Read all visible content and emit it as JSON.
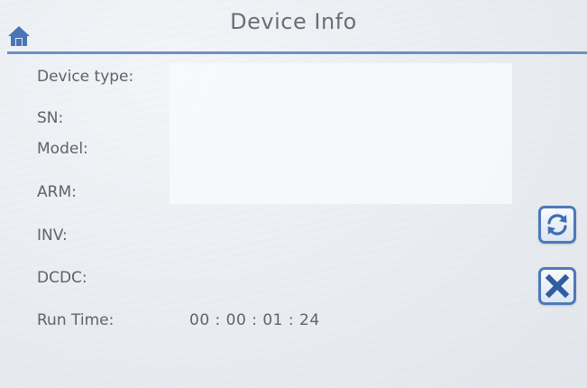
{
  "header": {
    "title": "Device Info",
    "home_icon": "home-icon"
  },
  "fields": [
    {
      "label": "Device type:",
      "value": ""
    },
    {
      "label": "SN:",
      "value": ""
    },
    {
      "label": "Model:",
      "value": ""
    },
    {
      "label": "ARM:",
      "value": ""
    },
    {
      "label": "INV:",
      "value": ""
    },
    {
      "label": "DCDC:",
      "value": ""
    },
    {
      "label": "Run Time:",
      "value": "00 : 00 : 01 : 24"
    }
  ],
  "buttons": {
    "refresh_icon": "refresh-icon",
    "close_icon": "close-icon"
  },
  "colors": {
    "accent": "#4e79b8",
    "header_line": "#6f8fc2",
    "text": "#5e636b"
  }
}
